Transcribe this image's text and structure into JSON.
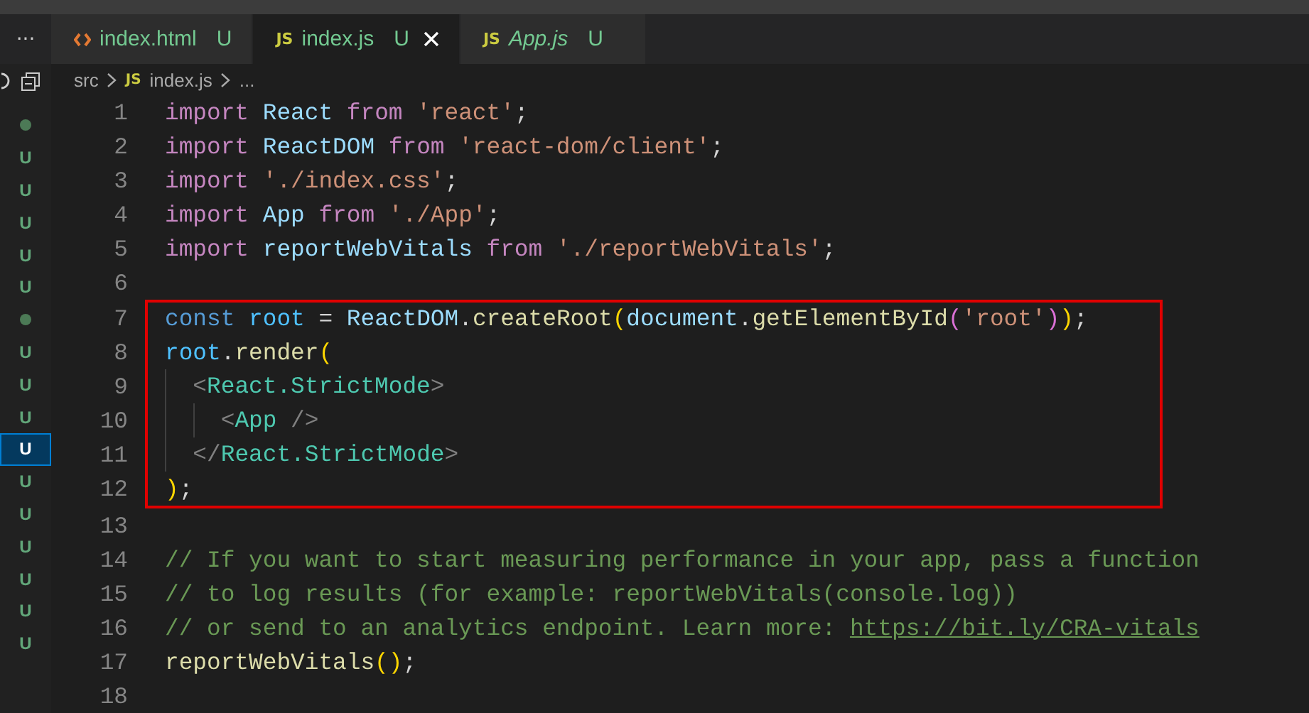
{
  "tab_bar": {
    "more": "···",
    "tabs": [
      {
        "label": "index.html",
        "kind": "html",
        "status": "U",
        "selected": false,
        "preview": false,
        "closable": false
      },
      {
        "label": "index.js",
        "kind": "js",
        "icon_text": "JS",
        "status": "U",
        "selected": true,
        "preview": false,
        "closable": true
      },
      {
        "label": "App.js",
        "kind": "js",
        "icon_text": "JS",
        "status": "U",
        "selected": false,
        "preview": true,
        "closable": false
      }
    ]
  },
  "breadcrumb": {
    "folder": "src",
    "file_icon": "JS",
    "file": "index.js",
    "more": "..."
  },
  "explorer_decorations": [
    {
      "kind": "dot",
      "selected": false
    },
    {
      "kind": "letter",
      "text": "U",
      "selected": false
    },
    {
      "kind": "letter",
      "text": "U",
      "selected": false
    },
    {
      "kind": "letter",
      "text": "U",
      "selected": false
    },
    {
      "kind": "letter",
      "text": "U",
      "selected": false
    },
    {
      "kind": "letter",
      "text": "U",
      "selected": false
    },
    {
      "kind": "dot",
      "selected": false
    },
    {
      "kind": "letter",
      "text": "U",
      "selected": false
    },
    {
      "kind": "letter",
      "text": "U",
      "selected": false
    },
    {
      "kind": "letter",
      "text": "U",
      "selected": false
    },
    {
      "kind": "letter",
      "text": "U",
      "selected": true
    },
    {
      "kind": "letter",
      "text": "U",
      "selected": false
    },
    {
      "kind": "letter",
      "text": "U",
      "selected": false
    },
    {
      "kind": "letter",
      "text": "U",
      "selected": false
    },
    {
      "kind": "letter",
      "text": "U",
      "selected": false
    },
    {
      "kind": "letter",
      "text": "U",
      "selected": false
    },
    {
      "kind": "letter",
      "text": "U",
      "selected": false
    }
  ],
  "editor": {
    "lines": [
      {
        "number": "1",
        "highlighted": false,
        "tokens": [
          {
            "text": "import ",
            "kind": "keyword"
          },
          {
            "text": "React ",
            "kind": "ident"
          },
          {
            "text": "from ",
            "kind": "keyword"
          },
          {
            "text": "'react'",
            "kind": "string"
          },
          {
            "text": ";",
            "kind": "punct"
          }
        ]
      },
      {
        "number": "2",
        "highlighted": false,
        "tokens": [
          {
            "text": "import ",
            "kind": "keyword"
          },
          {
            "text": "ReactDOM ",
            "kind": "ident"
          },
          {
            "text": "from ",
            "kind": "keyword"
          },
          {
            "text": "'react-dom/client'",
            "kind": "string"
          },
          {
            "text": ";",
            "kind": "punct"
          }
        ]
      },
      {
        "number": "3",
        "highlighted": false,
        "tokens": [
          {
            "text": "import ",
            "kind": "keyword"
          },
          {
            "text": "'./index.css'",
            "kind": "string"
          },
          {
            "text": ";",
            "kind": "punct"
          }
        ]
      },
      {
        "number": "4",
        "highlighted": false,
        "tokens": [
          {
            "text": "import ",
            "kind": "keyword"
          },
          {
            "text": "App ",
            "kind": "ident"
          },
          {
            "text": "from ",
            "kind": "keyword"
          },
          {
            "text": "'./App'",
            "kind": "string"
          },
          {
            "text": ";",
            "kind": "punct"
          }
        ]
      },
      {
        "number": "5",
        "highlighted": false,
        "tokens": [
          {
            "text": "import ",
            "kind": "keyword"
          },
          {
            "text": "reportWebVitals ",
            "kind": "ident"
          },
          {
            "text": "from ",
            "kind": "keyword"
          },
          {
            "text": "'./reportWebVitals'",
            "kind": "string"
          },
          {
            "text": ";",
            "kind": "punct"
          }
        ]
      },
      {
        "number": "6",
        "highlighted": false
      },
      {
        "number": "7",
        "highlighted": true,
        "tokens": [
          {
            "text": "const ",
            "kind": "storage"
          },
          {
            "text": "root ",
            "kind": "const"
          },
          {
            "text": "= ",
            "kind": "punct"
          },
          {
            "text": "ReactDOM",
            "kind": "ident"
          },
          {
            "text": ".",
            "kind": "punct"
          },
          {
            "text": "createRoot",
            "kind": "func"
          },
          {
            "text": "(",
            "kind": "paren"
          },
          {
            "text": "document",
            "kind": "ident"
          },
          {
            "text": ".",
            "kind": "punct"
          },
          {
            "text": "getElementById",
            "kind": "func"
          },
          {
            "text": "(",
            "kind": "paren2"
          },
          {
            "text": "'root'",
            "kind": "string"
          },
          {
            "text": ")",
            "kind": "paren2"
          },
          {
            "text": ")",
            "kind": "paren"
          },
          {
            "text": ";",
            "kind": "punct"
          }
        ]
      },
      {
        "number": "8",
        "highlighted": true,
        "tokens": [
          {
            "text": "root",
            "kind": "const"
          },
          {
            "text": ".",
            "kind": "punct"
          },
          {
            "text": "render",
            "kind": "func"
          },
          {
            "text": "(",
            "kind": "paren"
          }
        ]
      },
      {
        "number": "9",
        "highlighted": true,
        "tokens": [
          {
            "kind": "indent"
          },
          {
            "text": "<",
            "kind": "bracket"
          },
          {
            "text": "React.StrictMode",
            "kind": "tag"
          },
          {
            "text": ">",
            "kind": "bracket"
          }
        ]
      },
      {
        "number": "10",
        "highlighted": true,
        "tokens": [
          {
            "kind": "indent"
          },
          {
            "kind": "indent"
          },
          {
            "text": "<",
            "kind": "bracket"
          },
          {
            "text": "App ",
            "kind": "tag"
          },
          {
            "text": "/>",
            "kind": "bracket"
          }
        ]
      },
      {
        "number": "11",
        "highlighted": true,
        "tokens": [
          {
            "kind": "indent"
          },
          {
            "text": "</",
            "kind": "bracket"
          },
          {
            "text": "React.StrictMode",
            "kind": "tag"
          },
          {
            "text": ">",
            "kind": "bracket"
          }
        ]
      },
      {
        "number": "12",
        "highlighted": true,
        "tokens": [
          {
            "text": ")",
            "kind": "paren"
          },
          {
            "text": ";",
            "kind": "punct"
          }
        ]
      },
      {
        "number": "13",
        "highlighted": false
      },
      {
        "number": "14",
        "highlighted": false,
        "tokens": [
          {
            "text": "// If you want to start measuring performance in your app, pass a function",
            "kind": "comment"
          }
        ]
      },
      {
        "number": "15",
        "highlighted": false,
        "tokens": [
          {
            "text": "// to log results (for example: reportWebVitals(console.log))",
            "kind": "comment"
          }
        ]
      },
      {
        "number": "16",
        "highlighted": false,
        "tokens": [
          {
            "text": "// or send to an analytics endpoint. Learn more: ",
            "kind": "comment"
          },
          {
            "text": "https://bit.ly/CRA-vitals",
            "kind": "link"
          }
        ]
      },
      {
        "number": "17",
        "highlighted": false,
        "tokens": [
          {
            "text": "reportWebVitals",
            "kind": "func"
          },
          {
            "text": "(",
            "kind": "paren"
          },
          {
            "text": ")",
            "kind": "paren"
          },
          {
            "text": ";",
            "kind": "punct"
          }
        ]
      },
      {
        "number": "18",
        "highlighted": false
      }
    ]
  }
}
